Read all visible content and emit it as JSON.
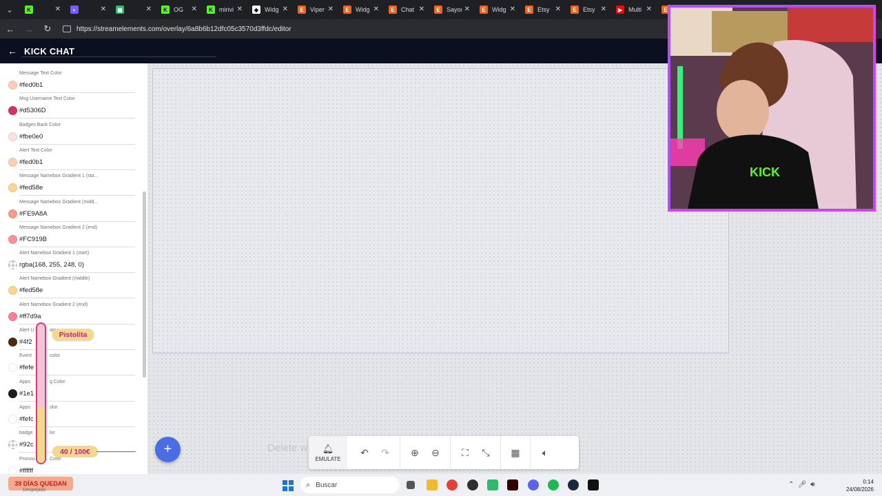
{
  "browser": {
    "tabs": [
      {
        "title": "",
        "color": "#53fc18",
        "glyph": "K"
      },
      {
        "title": "",
        "color": "#7b5cff",
        "glyph": "◐"
      },
      {
        "title": "",
        "color": "#2fb96b",
        "glyph": "▣"
      },
      {
        "title": "OG",
        "color": "#53fc18",
        "glyph": "K"
      },
      {
        "title": "mirivi",
        "color": "#53fc18",
        "glyph": "K"
      },
      {
        "title": "Widg",
        "color": "#ffffff",
        "glyph": "◆"
      },
      {
        "title": "Viper",
        "color": "#f1641e",
        "glyph": "E"
      },
      {
        "title": "Widg",
        "color": "#f1641e",
        "glyph": "E"
      },
      {
        "title": "Chat",
        "color": "#f1641e",
        "glyph": "E"
      },
      {
        "title": "Sayor",
        "color": "#f1641e",
        "glyph": "E"
      },
      {
        "title": "Widg",
        "color": "#f1641e",
        "glyph": "E"
      },
      {
        "title": "Etsy",
        "color": "#f1641e",
        "glyph": "E"
      },
      {
        "title": "Etsy",
        "color": "#f1641e",
        "glyph": "E"
      },
      {
        "title": "Multi",
        "color": "#ff0000",
        "glyph": "▶"
      },
      {
        "title": "Widg",
        "color": "#f1641e",
        "glyph": "E"
      },
      {
        "title": "Strea",
        "color": "#ffffff",
        "glyph": "⚓"
      }
    ],
    "url": "https://streamelements.com/overlay/6a8b6b12dfc05c3570d3ffdc/editor"
  },
  "header": {
    "title": "KICK CHAT"
  },
  "fields": [
    {
      "label": "Message Text Color",
      "value": "#fed0b1",
      "swatch": "#fed0b1"
    },
    {
      "label": "Msg Username Text Color",
      "value": "#d5306D",
      "swatch": "#d5306d"
    },
    {
      "label": "Badges Back Color",
      "value": "#fbe0e0",
      "swatch": "#fbe0e0"
    },
    {
      "label": "Alert Text Color",
      "value": "#fed0b1",
      "swatch": "#fed0b1"
    },
    {
      "label": "Message Namebox Gradient 1 (sta...",
      "value": "#fed58e",
      "swatch": "#fed58e"
    },
    {
      "label": "Message Namebox Gradient (midd...",
      "value": "#FE9A8A",
      "swatch": "#fe9a8a"
    },
    {
      "label": "Message Namebox Gradient 2 (end)",
      "value": "#FC919B",
      "swatch": "#fc919b"
    },
    {
      "label": "Alert Namebox Gradient 1 (start)",
      "value": "rgba(168, 255, 248, 0)",
      "swatch": "checker"
    },
    {
      "label": "Alert Namebox Gradient (middle)",
      "value": "#fed58e",
      "swatch": "#fed58e"
    },
    {
      "label": "Alert Namebox Gradient 2 (end)",
      "value": "#ff7d9a",
      "swatch": "#ff7d9a"
    },
    {
      "label": "Alert U",
      "value": "#4f2",
      "swatch": "#4f2a10"
    },
    {
      "label": "Event",
      "value": "#fefe",
      "swatch": "#fefefe"
    },
    {
      "label": "Apps",
      "value": "#1e1",
      "swatch": "#1e1e1e"
    },
    {
      "label": "Apps",
      "value": "#fefc",
      "swatch": "#fefcfc"
    },
    {
      "label": "badge",
      "value": "#92c",
      "swatch": "checker"
    },
    {
      "label": "Pronou",
      "value": "#ffffff",
      "swatch": "#ffffff"
    }
  ],
  "field_suffixes": [
    "",
    "",
    "",
    "",
    "",
    "",
    "",
    "",
    "",
    "",
    "am",
    "color",
    "g Color",
    "olor",
    "lor",
    "Color"
  ],
  "editor": {
    "add_label": "+",
    "delete_hint": "Delete w",
    "emulate_label": "EMULATE"
  },
  "overlay_widgets": {
    "donor_name": "Pistolita",
    "goal_text": "40 / 100€",
    "goal_fraction": 0.4,
    "days_left": "39 DÍAS QUEDAN",
    "days_sub": "Despejado"
  },
  "taskbar": {
    "search_placeholder": "Buscar",
    "time": "0:14",
    "date": "24/08/2026"
  }
}
